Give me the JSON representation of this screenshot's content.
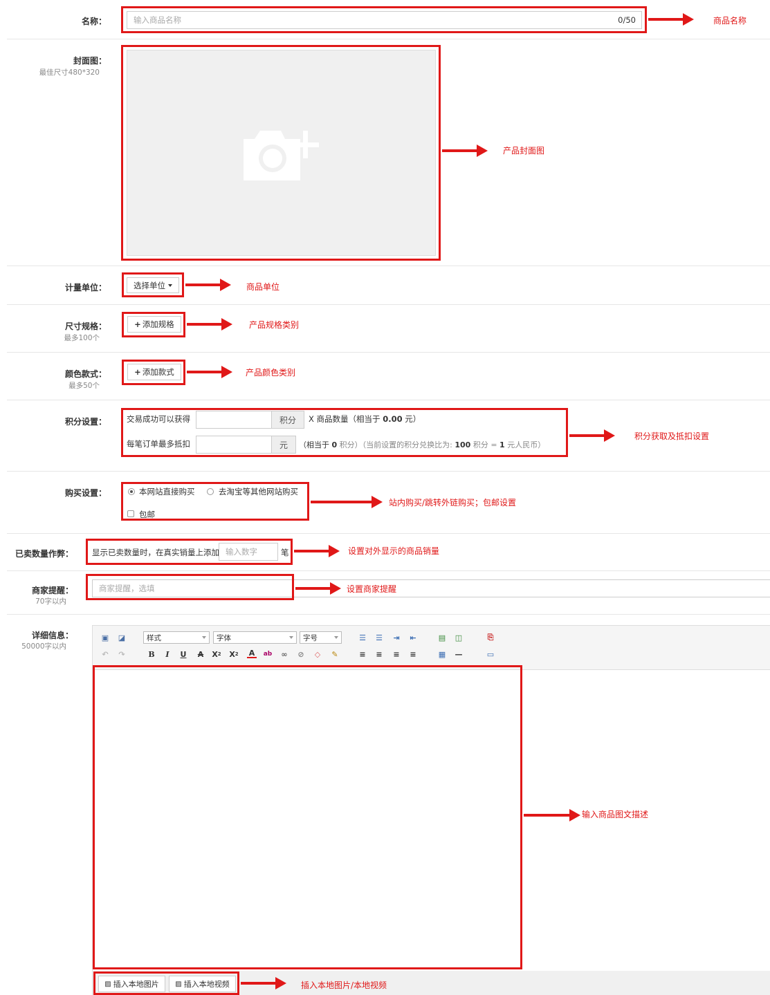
{
  "name": {
    "label": "名称：",
    "placeholder": "输入商品名称",
    "counter": "0/50",
    "note": "商品名称"
  },
  "cover": {
    "label": "封面图：",
    "hint": "最佳尺寸480*320",
    "note": "产品封面图",
    "icon": "camera-plus-icon"
  },
  "unit": {
    "label": "计量单位：",
    "select_label": "选择单位",
    "note": "商品单位"
  },
  "spec": {
    "label": "尺寸规格：",
    "hint": "最多100个",
    "button": "添加规格",
    "note": "产品规格类别"
  },
  "color": {
    "label": "颜色款式：",
    "hint": "最多50个",
    "button": "添加款式",
    "note": "产品颜色类别"
  },
  "points": {
    "label": "积分设置：",
    "earn_prefix": "交易成功可以获得",
    "earn_addon": "积分",
    "earn_suffix_a": "X 商品数量（相当于 ",
    "earn_value": "0.00",
    "earn_suffix_b": " 元）",
    "deduct_prefix": "每笔订单最多抵扣",
    "deduct_addon": "元",
    "deduct_a": "（相当于 ",
    "deduct_points": "0",
    "deduct_b": " 积分）（当前设置的积分兑换比为: ",
    "ratio_points": "100",
    "deduct_c": " 积分 = ",
    "ratio_yuan": "1",
    "deduct_d": " 元人民币）",
    "note": "积分获取及抵扣设置"
  },
  "purchase": {
    "label": "购买设置：",
    "option_direct": "本网站直接购买",
    "option_external": "去淘宝等其他网站购买",
    "free_shipping": "包邮",
    "note": "站内购买/跳转外链购买；包邮设置"
  },
  "sold": {
    "label": "已卖数量作弊：",
    "prefix": "显示已卖数量时，在真实销量上添加",
    "placeholder": "输入数字",
    "suffix": "笔",
    "note": "设置对外显示的商品销量"
  },
  "reminder": {
    "label": "商家提醒：",
    "hint": "70字以内",
    "placeholder": "商家提醒，选填",
    "note": "设置商家提醒"
  },
  "detail": {
    "label": "详细信息：",
    "hint": "50000字以内",
    "style_select": "样式",
    "font_select": "字体",
    "size_select": "字号",
    "note": "输入商品图文描述",
    "insert_image": "插入本地图片",
    "insert_video": "插入本地视频",
    "insert_note": "插入本地图片/本地视频"
  },
  "colors": {
    "annotation": "#e01818",
    "border": "#cccccc"
  }
}
